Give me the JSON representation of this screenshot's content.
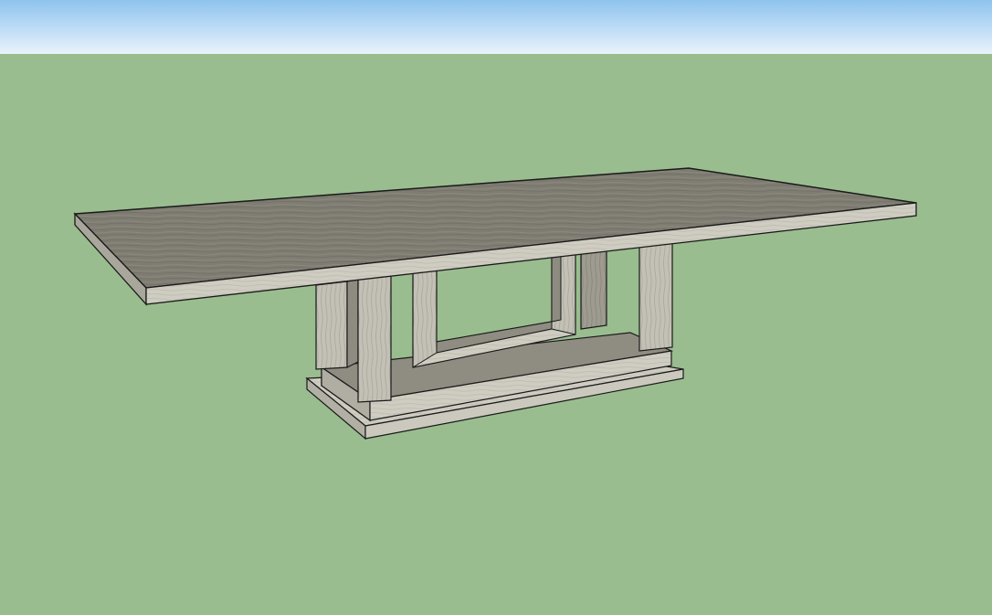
{
  "viewport": {
    "colors": {
      "sky_top": "#8ec3ef",
      "sky_bottom": "#e9f3fb",
      "ground": "#99bd8f",
      "edge": "#1a1a1a",
      "tabletop_face": "#7f7c72",
      "tabletop_edge": "#c9c8bd",
      "wood_light": "#d0cfc4",
      "wood_mid": "#b8b6aa",
      "wood_dark": "#8e8b81",
      "wood_shadow": "#6f6d64"
    },
    "model": {
      "object": "pedestal table",
      "parts": [
        "tabletop",
        "pedestal-base",
        "base-plinth",
        "leg-posts",
        "u-frame"
      ]
    }
  }
}
